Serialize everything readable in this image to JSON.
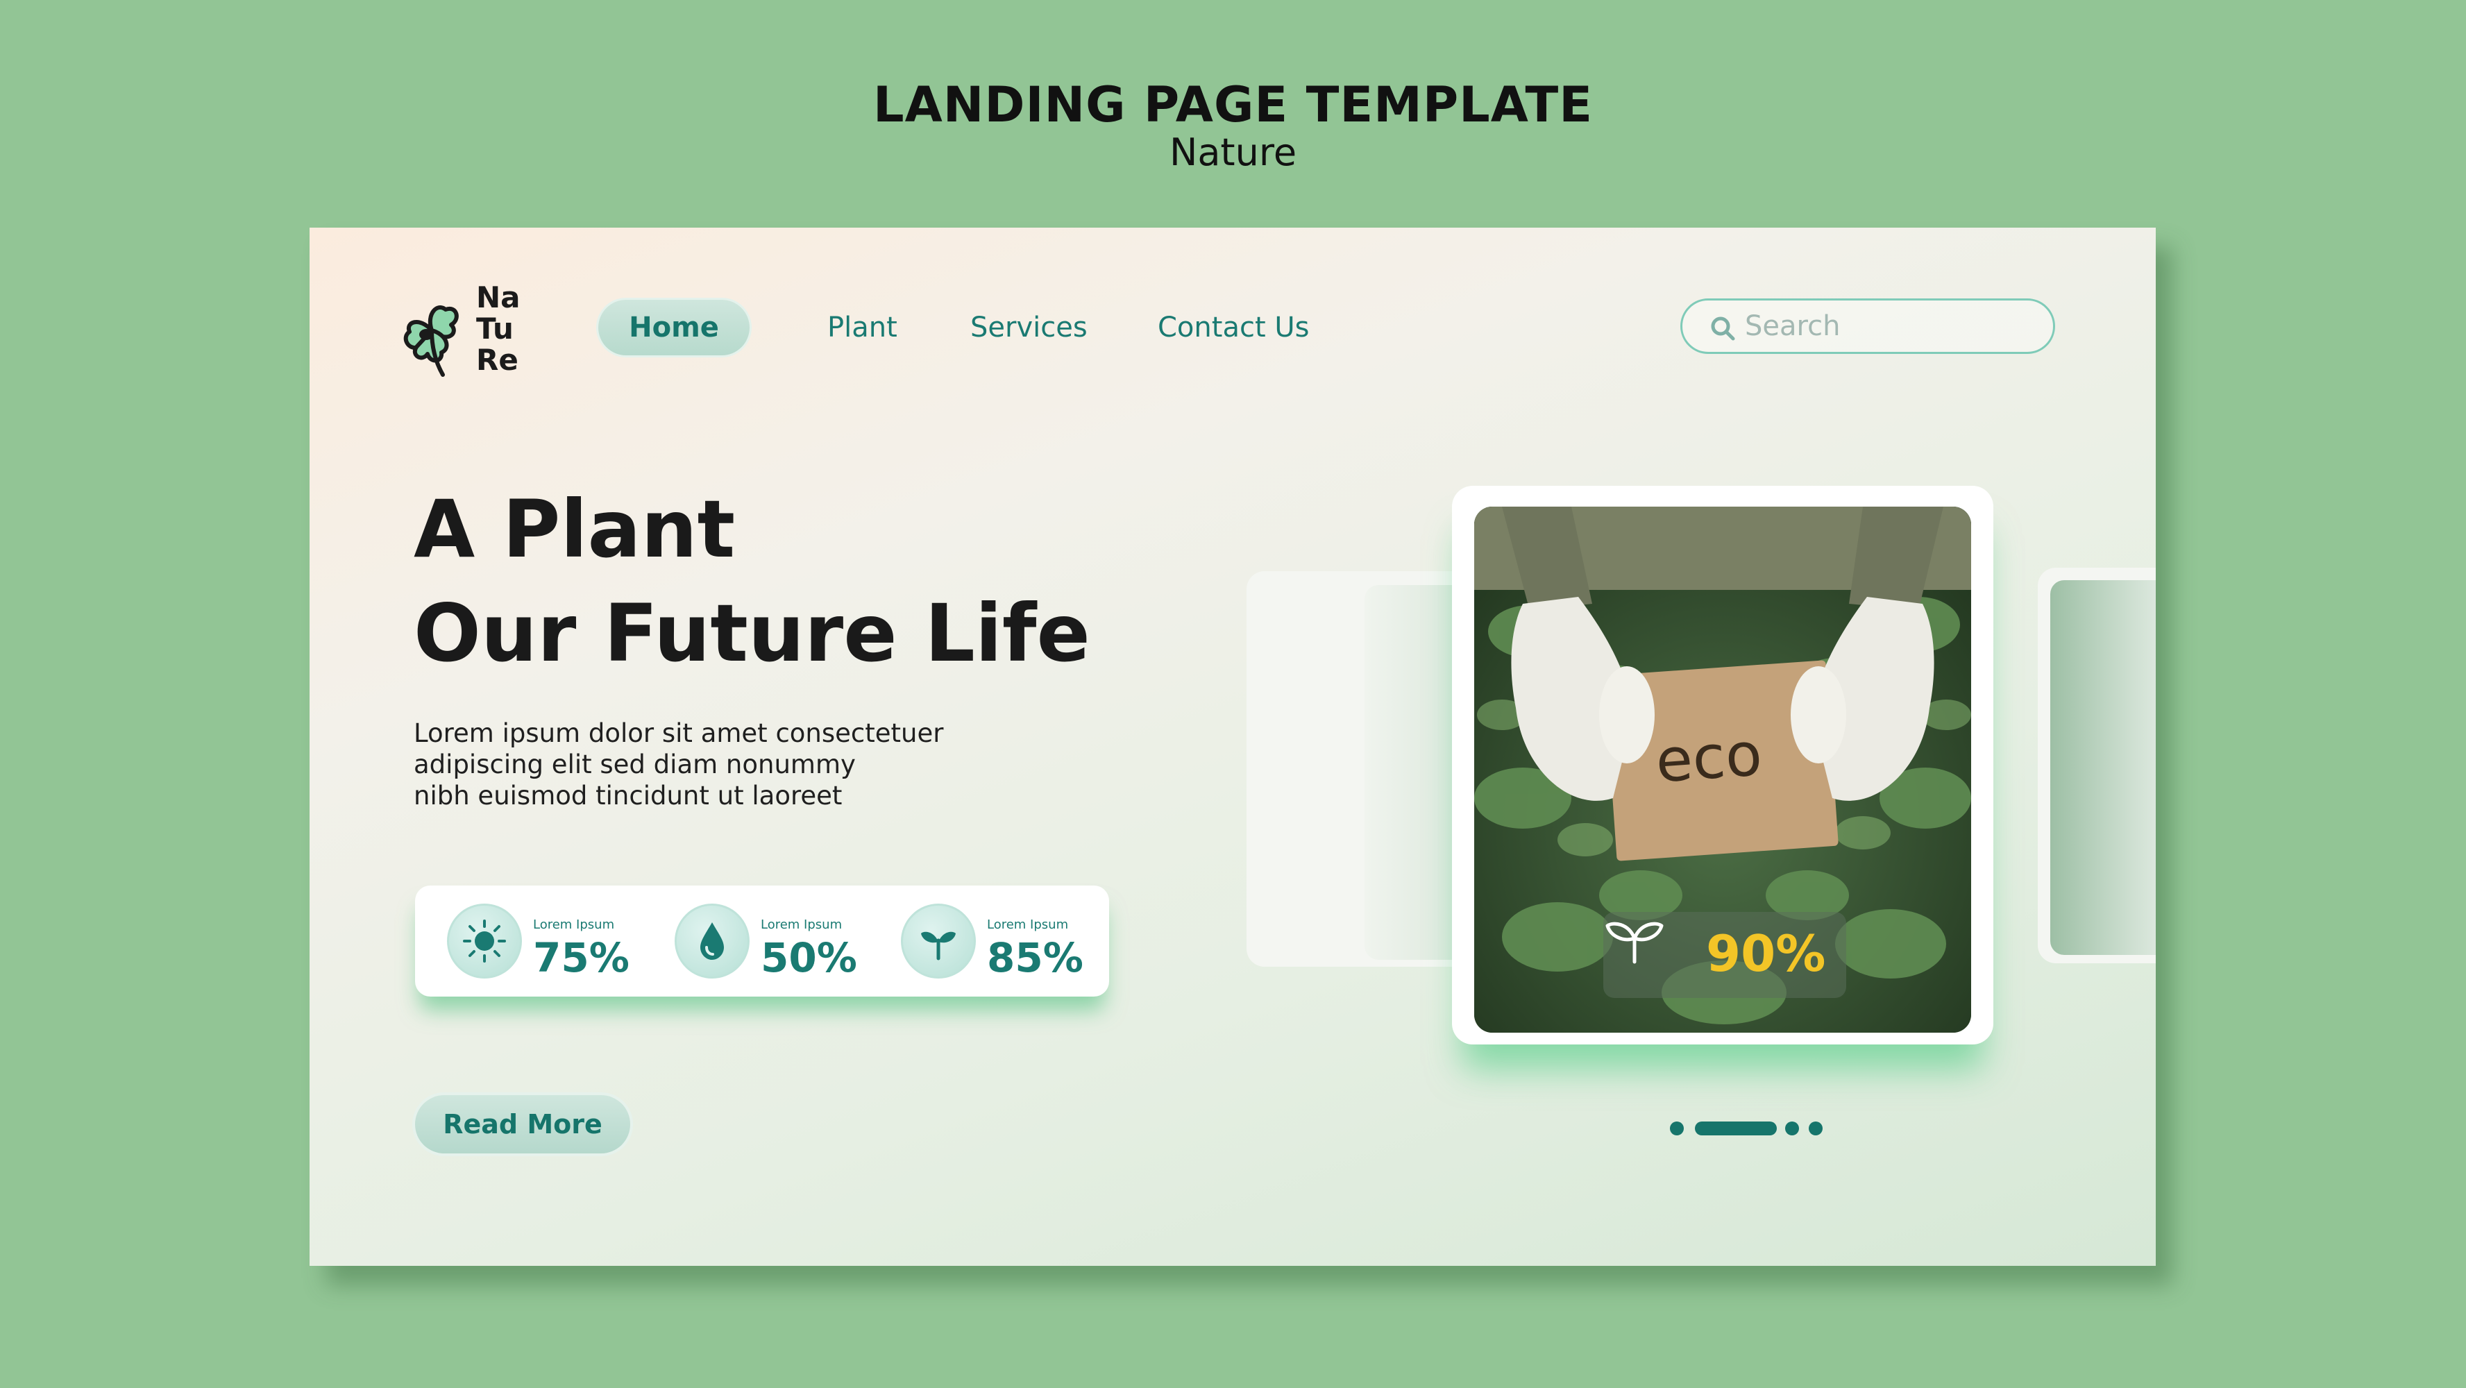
{
  "presentation": {
    "title": "LANDING PAGE TEMPLATE",
    "subtitle": "Nature"
  },
  "logo": {
    "lines": [
      "Na",
      "Tu",
      "Re"
    ],
    "icon": "clover-icon"
  },
  "nav": {
    "items": [
      {
        "label": "Home",
        "active": true
      },
      {
        "label": "Plant",
        "active": false
      },
      {
        "label": "Services",
        "active": false
      },
      {
        "label": "Contact Us",
        "active": false
      }
    ]
  },
  "search": {
    "placeholder": "Search",
    "icon": "search-icon"
  },
  "hero": {
    "title_lines": [
      "A Plant",
      "Our Future Life"
    ],
    "description_lines": [
      "Lorem ipsum dolor sit amet consectetuer",
      "adipiscing elit sed diam nonummy",
      "nibh euismod tincidunt ut laoreet"
    ],
    "read_more_label": "Read More"
  },
  "stats": [
    {
      "label": "Lorem Ipsum",
      "value": "75%",
      "icon": "sun-icon"
    },
    {
      "label": "Lorem Ipsum",
      "value": "50%",
      "icon": "water-drop-icon"
    },
    {
      "label": "Lorem Ipsum",
      "value": "85%",
      "icon": "sprout-icon"
    }
  ],
  "gallery": {
    "photo_sign_text": "eco",
    "badge_value": "90%",
    "badge_icon": "sprout-icon",
    "slide_count": 4,
    "active_slide": 1
  },
  "colors": {
    "background": "#92c595",
    "accent": "#16756b",
    "badge": "#f3c527"
  }
}
